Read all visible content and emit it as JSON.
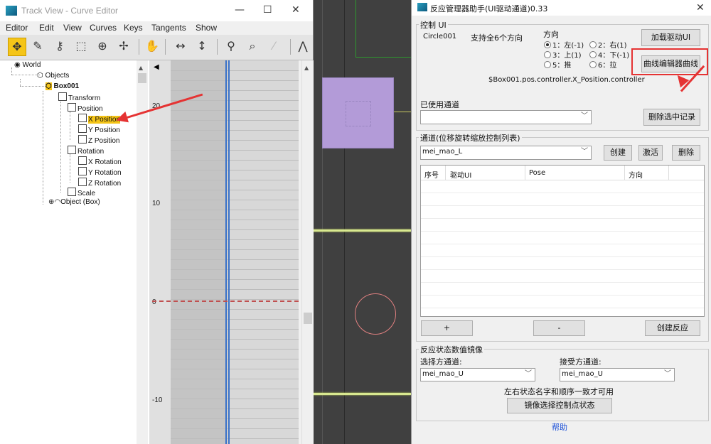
{
  "track_view": {
    "title": "Track View - Curve Editor",
    "menu": [
      "Editor",
      "Edit",
      "View",
      "Curves",
      "Keys",
      "Tangents",
      "Show"
    ],
    "tree": {
      "world": "World",
      "objects": "Objects",
      "box": "Box001",
      "transform": "Transform",
      "position": "Position",
      "xpos": "X Position",
      "ypos": "Y Position",
      "zpos": "Z Position",
      "rotation": "Rotation",
      "xrot": "X Rotation",
      "yrot": "Y Rotation",
      "zrot": "Z Rotation",
      "scale": "Scale",
      "object": "Object (Box)"
    },
    "ticks": [
      "20",
      "10",
      "0",
      "-10"
    ],
    "selected_track_color": "#f5c518"
  },
  "panel": {
    "title": "反应管理器助手(UI驱动通道)0.33",
    "control_group": "控制 UI",
    "circle_name": "Circle001",
    "support_text": "支持全6个方向",
    "direction_label": "方向",
    "radios": [
      "1：左(-1)",
      "2：右(1)",
      "3：上(1)",
      "4：下(-1)",
      "5：推",
      "6：拉"
    ],
    "load_button": "加载驱动UI",
    "curve_button": "曲线编辑器曲线",
    "controller_path": "$Box001.pos.controller.X_Position.controller",
    "used_channel": "已使用通道",
    "used_value": "",
    "delete_button": "删除选中记录",
    "channel_group": "通道(位移旋转缩放控制列表)",
    "channel_value": "mei_mao_L",
    "create_button": "创建",
    "activate_button": "激活",
    "remove_button": "删除",
    "columns": [
      "序号",
      "驱动UI",
      "Pose",
      "方向"
    ],
    "add_button": "+",
    "minus_button": "-",
    "create_reaction_button": "创建反应",
    "mirror_group": "反应状态数值镜像",
    "select_source": "选择方通道:",
    "receive_target": "接受方通道:",
    "source_value": "mei_mao_U",
    "target_value": "mei_mao_U",
    "note": "左右状态名字和顺序一致才可用",
    "mirror_button": "镜像选择控制点状态",
    "help": "帮助",
    "help_color": "#1a4fd8",
    "highlight_color": "#e53333"
  }
}
